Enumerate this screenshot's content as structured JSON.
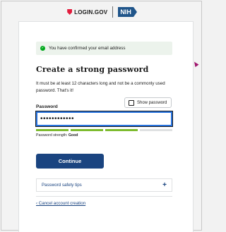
{
  "header": {
    "login_logo_text": "LOGIN.GOV",
    "partner_logo_text": "NIH"
  },
  "banner": {
    "message": "You have confirmed your email address",
    "icon": "check-circle-icon"
  },
  "main": {
    "title": "Create a strong password",
    "intro": "It must be at least 12 characters long and not be a commonly used password. That's it!"
  },
  "password": {
    "label": "Password",
    "value": "••••••••••••",
    "show_toggle_label": "Show password",
    "show_toggle_checked": false,
    "strength_label": "Password strength:",
    "strength_value": "Good",
    "strength_segments_filled": 3,
    "strength_segments_total": 4
  },
  "actions": {
    "continue_label": "Continue",
    "safety_tips_label": "Password safety tips",
    "cancel_label": "‹ Cancel account creation"
  },
  "colors": {
    "primary": "#1a4480",
    "success": "#00a91c",
    "strength_fill": "#7dbb2e",
    "brand_red": "#e21c3d",
    "nih_blue": "#20558a"
  }
}
